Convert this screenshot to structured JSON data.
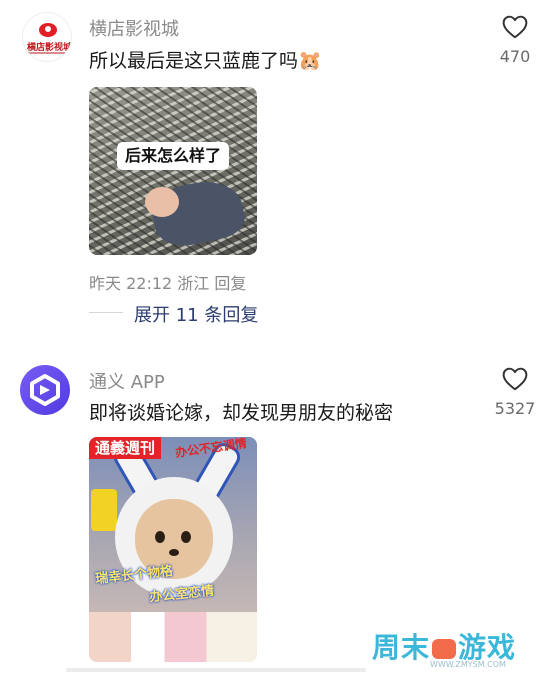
{
  "comments": [
    {
      "avatar_text": "横店影视城",
      "name": "横店影视城",
      "text": "所以最后是这只蓝鹿了吗",
      "emoji": "🐹",
      "likes": "470",
      "image_caption": "后来怎么样了",
      "meta_time": "昨天 22:12",
      "meta_location": "浙江",
      "meta_reply": "回复",
      "expand_replies": "展开 11 条回复"
    },
    {
      "name": "通义 APP",
      "text": "即将谈婚论嫁，却发现男朋友的秘密",
      "likes": "5327",
      "image_badge_left": "通義週刊",
      "image_badge_right": "办公不忘调情",
      "image_text_1": "瑞幸长个物格",
      "image_text_2": "办公室恋情"
    }
  ],
  "watermark": {
    "left": "周末",
    "right": "游戏",
    "url": "WWW.ZMYSM.COM"
  },
  "colors": {
    "accent_link": "#2c3d70",
    "muted_text": "#8a8a8a",
    "avatar2": "#5b45e8",
    "watermark": "#3bb8d9"
  },
  "icons": [
    "heart-outline-icon",
    "tongyi-logo-icon",
    "gamepad-icon"
  ]
}
